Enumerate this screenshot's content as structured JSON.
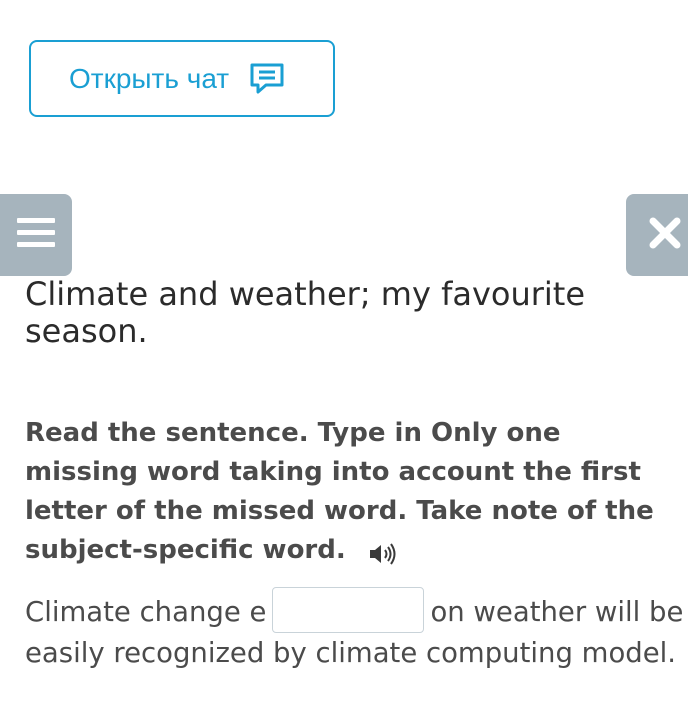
{
  "chat_button": {
    "label": "Открыть чат",
    "icon": "chat-bubble-icon",
    "color": "#1a9fd3"
  },
  "menu_button": {
    "icon": "hamburger-menu-icon",
    "background": "#a6b4bd"
  },
  "close_button": {
    "icon": "close-icon",
    "background": "#a6b4bd"
  },
  "lesson": {
    "title": "Climate and weather; my favourite season."
  },
  "task": {
    "instruction": "Read the sentence. Type in Only one missing word taking into account the first letter of the missed word. Take note of the subject-specific word.",
    "audio_icon": "speaker-icon"
  },
  "sentence": {
    "before": "Climate change e",
    "answer_value": "",
    "after": "on weather will be easily recognized by climate computing model."
  }
}
